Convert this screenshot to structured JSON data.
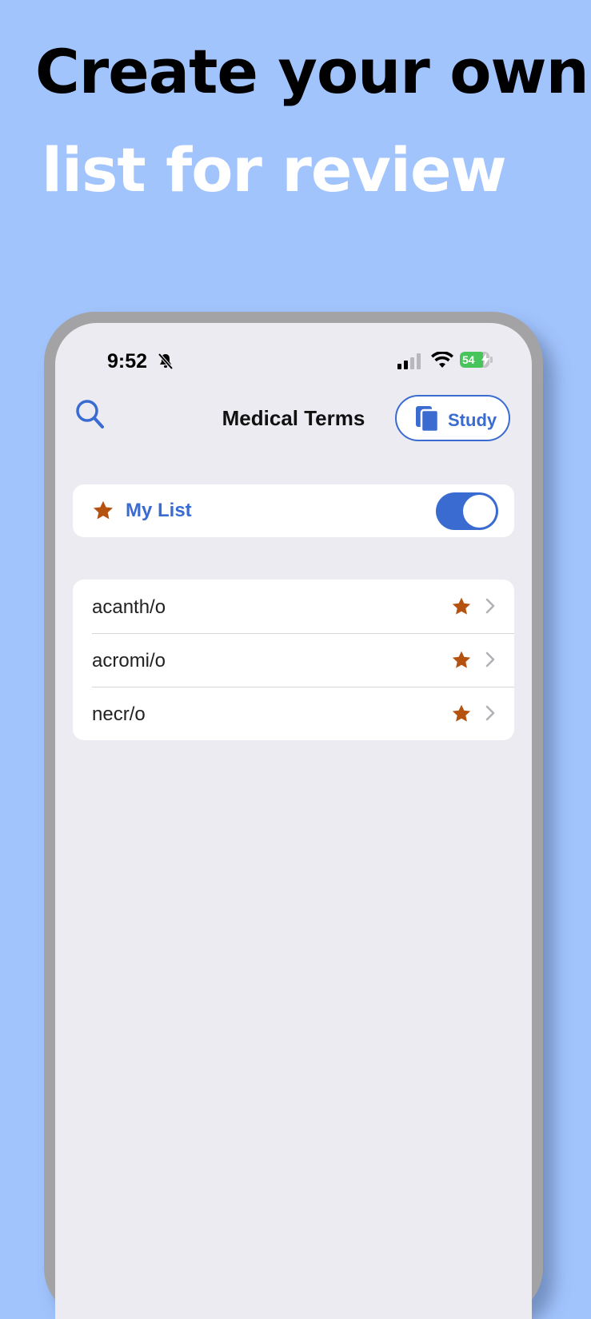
{
  "headline": {
    "line1": "Create your own",
    "line2": "list for review"
  },
  "status_bar": {
    "time": "9:52",
    "battery": "54"
  },
  "nav": {
    "title": "Medical Terms",
    "study_label": "Study"
  },
  "my_list": {
    "label": "My List",
    "enabled": true
  },
  "terms": [
    {
      "label": "acanth/o",
      "starred": true
    },
    {
      "label": "acromi/o",
      "starred": true
    },
    {
      "label": "necr/o",
      "starred": true
    }
  ],
  "colors": {
    "background": "#a2c4fd",
    "accent": "#3a6bd1",
    "star": "#b5520f",
    "screen": "#ebebf1"
  }
}
